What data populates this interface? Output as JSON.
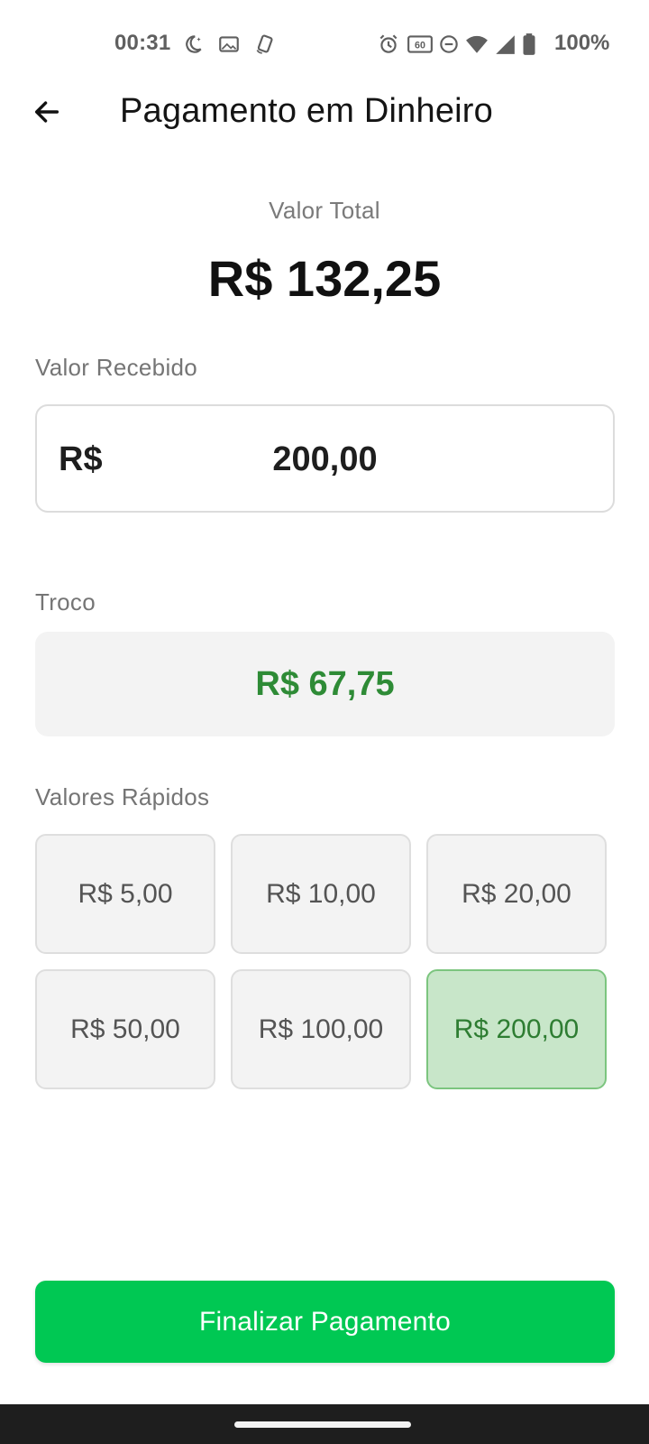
{
  "status_bar": {
    "time": "00:31",
    "battery_text": "100%",
    "icons": [
      "moon-icon",
      "image-icon",
      "rotate-icon",
      "alarm-icon",
      "refresh-rate-icon",
      "do-not-disturb-icon",
      "wifi-icon",
      "signal-icon",
      "battery-icon"
    ]
  },
  "header": {
    "title": "Pagamento em Dinheiro",
    "back_icon": "arrow-left-icon"
  },
  "total": {
    "label": "Valor Total",
    "value": "R$ 132,25"
  },
  "received": {
    "label": "Valor Recebido",
    "prefix": "R$",
    "value": "200,00"
  },
  "change": {
    "label": "Troco",
    "value": "R$ 67,75",
    "color": "#2e8b36"
  },
  "quick_values": {
    "label": "Valores Rápidos",
    "items": [
      {
        "label": "R$ 5,00",
        "selected": false
      },
      {
        "label": "R$ 10,00",
        "selected": false
      },
      {
        "label": "R$ 20,00",
        "selected": false
      },
      {
        "label": "R$ 50,00",
        "selected": false
      },
      {
        "label": "R$ 100,00",
        "selected": false
      },
      {
        "label": "R$ 200,00",
        "selected": true
      }
    ],
    "selected_color": "#c8e6c9"
  },
  "actions": {
    "finalize_label": "Finalizar Pagamento",
    "finalize_color": "#00c853"
  }
}
